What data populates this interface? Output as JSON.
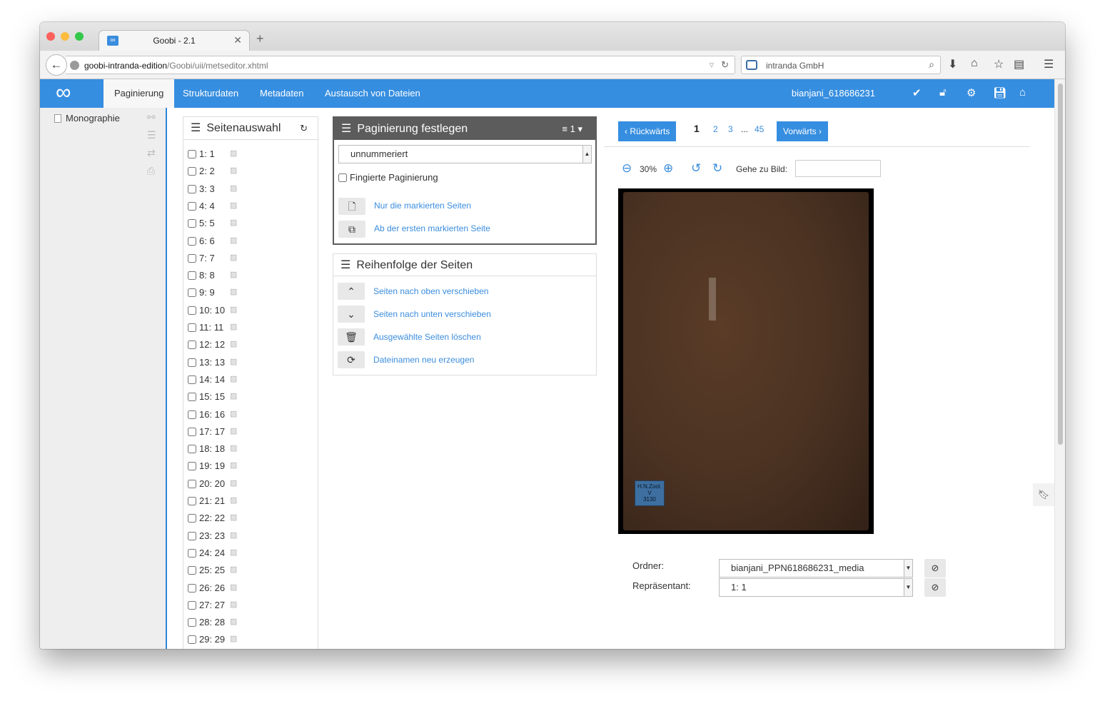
{
  "browser": {
    "tab_title": "Goobi - 2.1",
    "tab_favicon": "∞",
    "url_host": "goobi-intranda-edition",
    "url_path": "/Goobi/uii/metseditor.xhtml",
    "search_engine_text": "intranda GmbH"
  },
  "nav": {
    "logo": "∞",
    "items": [
      "Paginierung",
      "Strukturdaten",
      "Metadaten",
      "Austausch von Dateien"
    ],
    "active": "Paginierung",
    "user": "bianjani_618686231",
    "icons": [
      "check-icon",
      "unlock-icon",
      "gear-icon",
      "save-icon",
      "home-icon"
    ]
  },
  "sidebar": {
    "root": "Monographie"
  },
  "seitenauswahl": {
    "title": "Seitenauswahl",
    "pages": [
      "1: 1",
      "2: 2",
      "3: 3",
      "4: 4",
      "5: 5",
      "6: 6",
      "7: 7",
      "8: 8",
      "9: 9",
      "10: 10",
      "11: 11",
      "12: 12",
      "13: 13",
      "14: 14",
      "15: 15",
      "16: 16",
      "17: 17",
      "18: 18",
      "19: 19",
      "20: 20",
      "21: 21",
      "22: 22",
      "23: 23",
      "24: 24",
      "25: 25",
      "26: 26",
      "27: 27",
      "28: 28",
      "29: 29"
    ]
  },
  "paginierung": {
    "title": "Paginierung festlegen",
    "count_label": "1",
    "select_value": "unnummeriert",
    "fingiert_label": "Fingierte Paginierung",
    "actions": [
      "Nur die markierten Seiten",
      "Ab der ersten markierten Seite"
    ]
  },
  "reihenfolge": {
    "title": "Reihenfolge der Seiten",
    "actions": [
      "Seiten nach oben verschieben",
      "Seiten nach unten verschieben",
      "Ausgewählte Seiten löschen",
      "Dateinamen neu erzeugen"
    ]
  },
  "viewer": {
    "back_label": "Rückwärts",
    "forward_label": "Vorwärts",
    "pages": [
      "1",
      "2",
      "3",
      "...",
      "45"
    ],
    "current_page": "1",
    "zoom": "30%",
    "goto_label": "Gehe zu Bild:",
    "goto_value": "",
    "label_text": "H.N.Zool.\nV\n3130",
    "ordner_label": "Ordner:",
    "ordner_value": "bianjani_PPN618686231_media",
    "repraesentant_label": "Repräsentant:",
    "repraesentant_value": "1: 1"
  },
  "colors": {
    "accent": "#368ee0",
    "panel_header_dark": "#5c5c5c",
    "book_cover": "#4a3222"
  }
}
